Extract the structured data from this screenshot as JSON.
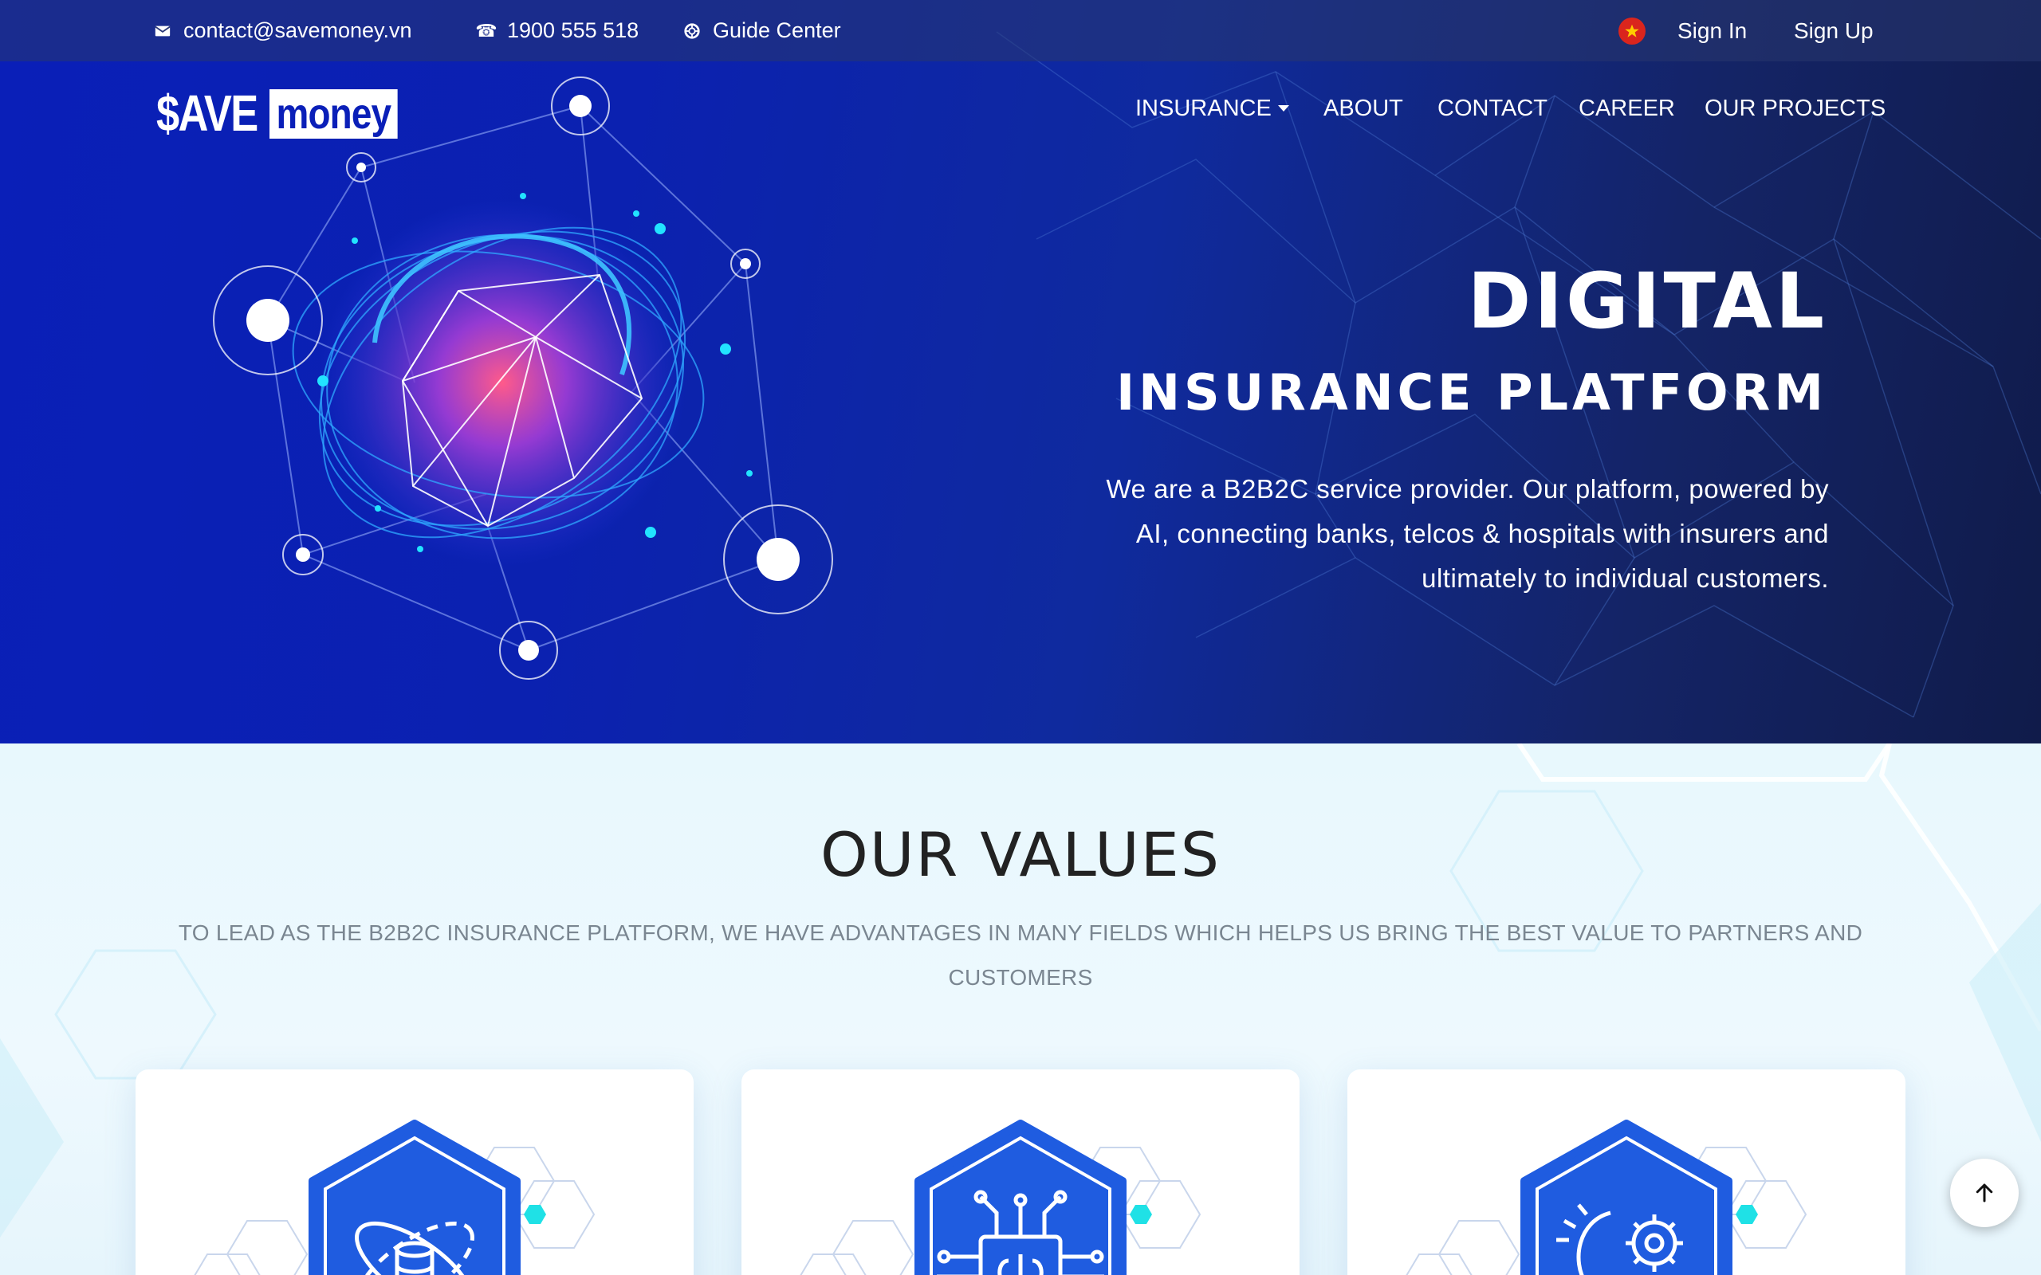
{
  "topbar": {
    "email": "contact@savemoney.vn",
    "phone": "1900 555 518",
    "guide": "Guide Center",
    "sign_in": "Sign In",
    "sign_up": "Sign Up"
  },
  "logo": {
    "save": "$AVE",
    "money": "money"
  },
  "nav": {
    "insurance": "INSURANCE",
    "about": "ABOUT",
    "contact": "CONTACT",
    "career": "CAREER",
    "projects": "OUR PROJECTS"
  },
  "hero": {
    "title": "DIGITAL",
    "subtitle": "INSURANCE PLATFORM",
    "desc_line1": "We are a B2B2C service provider. Our platform, powered by",
    "desc_line2": "AI, connecting banks, telcos & hospitals with insurers and",
    "desc_line3": "ultimately to individual customers."
  },
  "values": {
    "title": "OUR VALUES",
    "desc": "TO LEAD AS THE B2B2C INSURANCE PLATFORM, WE HAVE ADVANTAGES IN MANY FIELDS WHICH HELPS US BRING THE BEST VALUE TO PARTNERS AND CUSTOMERS",
    "cards": [
      {
        "icon": "database-orbit-icon"
      },
      {
        "icon": "ai-brain-chip-icon"
      },
      {
        "icon": "gear-head-icon"
      }
    ]
  },
  "colors": {
    "hero_blue": "#0a1fb8",
    "accent_cyan": "#00d8e8",
    "icon_blue": "#1f5ce0"
  }
}
